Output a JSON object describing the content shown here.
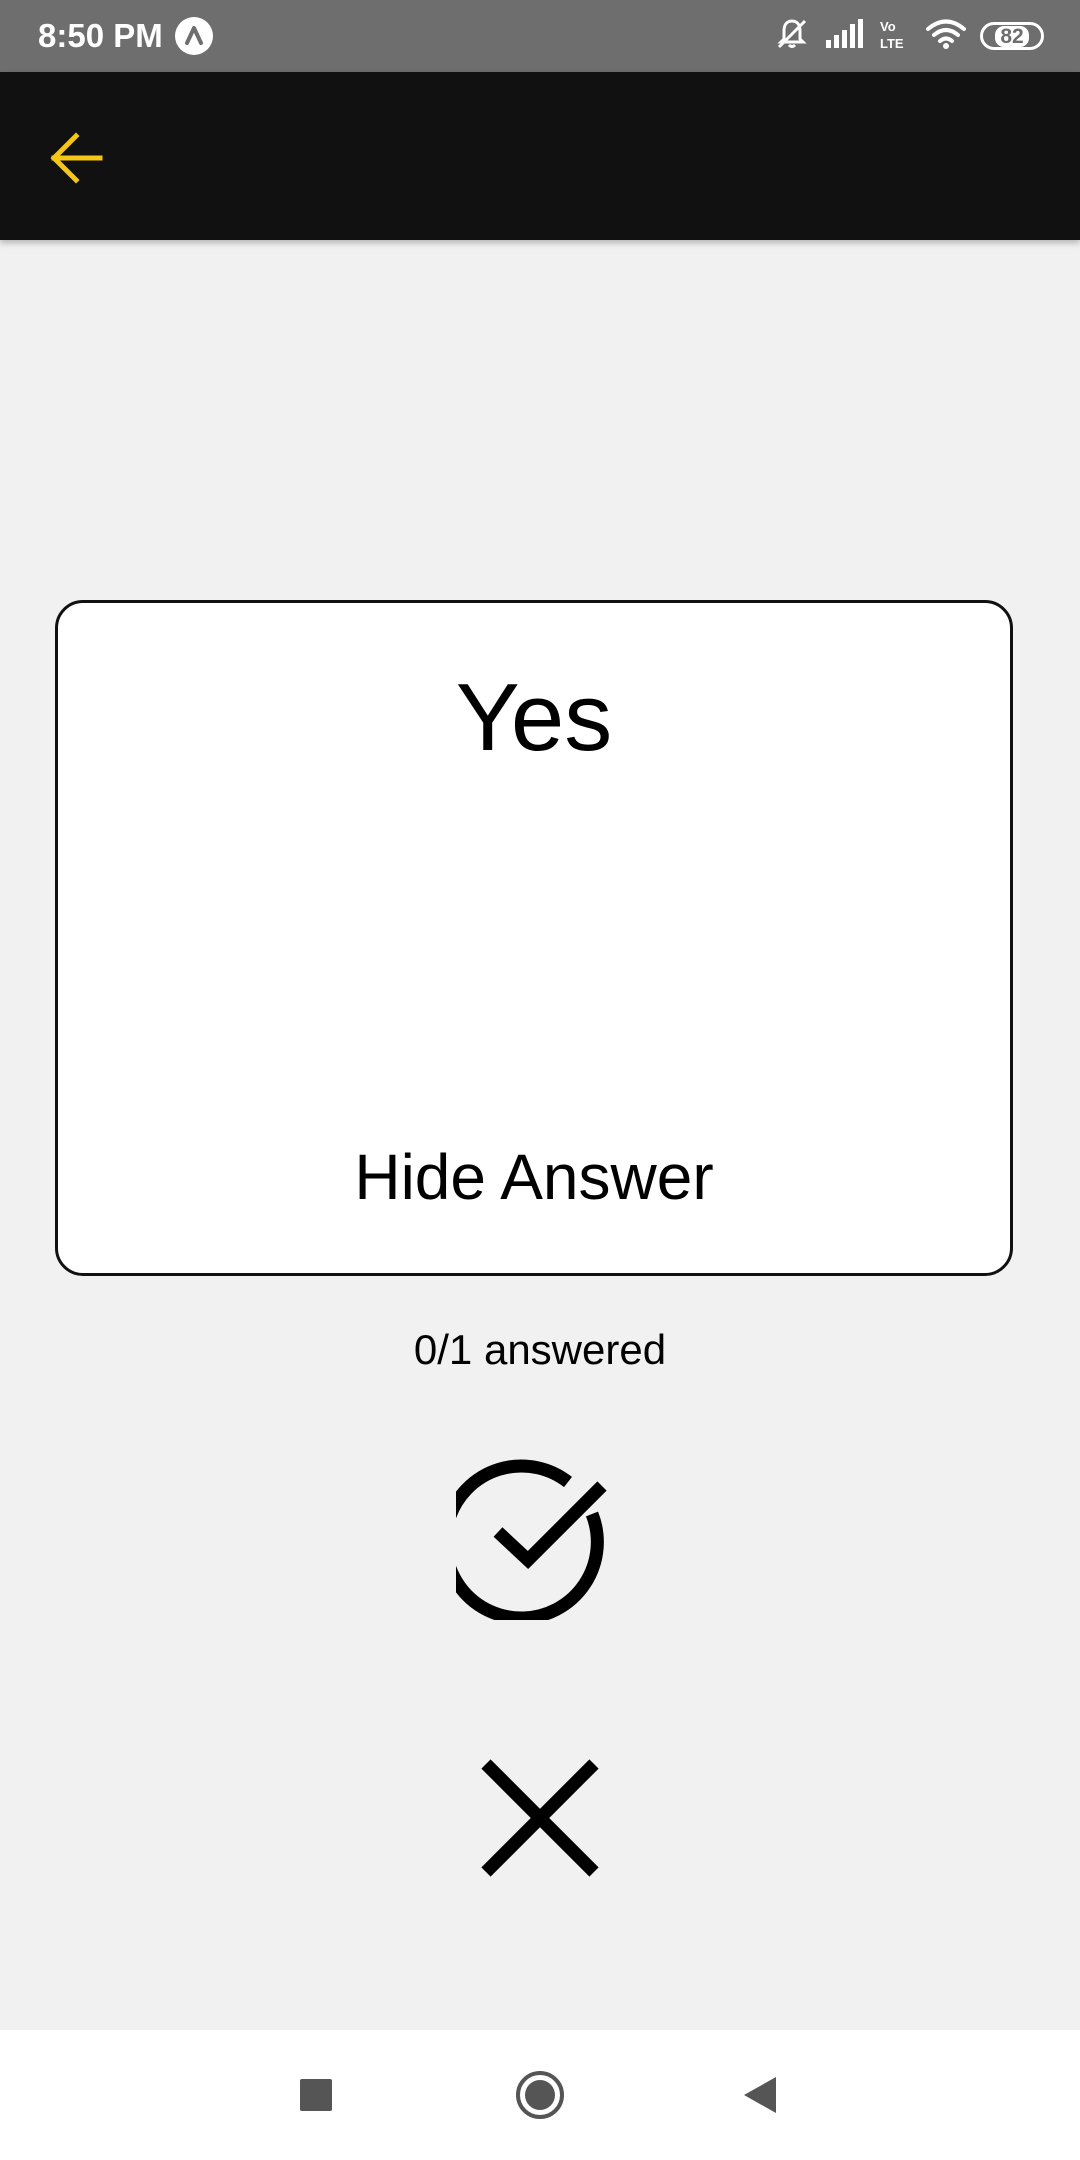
{
  "status_bar": {
    "time": "8:50 PM",
    "battery_level": "82",
    "icons": [
      "app-notification-icon",
      "muted-bell-icon",
      "signal-icon",
      "volte-icon",
      "wifi-icon",
      "battery-icon"
    ]
  },
  "app_bar": {
    "back_icon": "arrow-left-icon",
    "accent_color": "#f5c518"
  },
  "card": {
    "answer": "Yes",
    "toggle_label": "Hide Answer"
  },
  "progress": {
    "text": "0/1 answered"
  },
  "actions": {
    "correct_icon": "check-circle-icon",
    "wrong_icon": "close-icon"
  },
  "nav_bar": {
    "icons": [
      "recents-square-icon",
      "home-circle-icon",
      "back-triangle-icon"
    ]
  }
}
